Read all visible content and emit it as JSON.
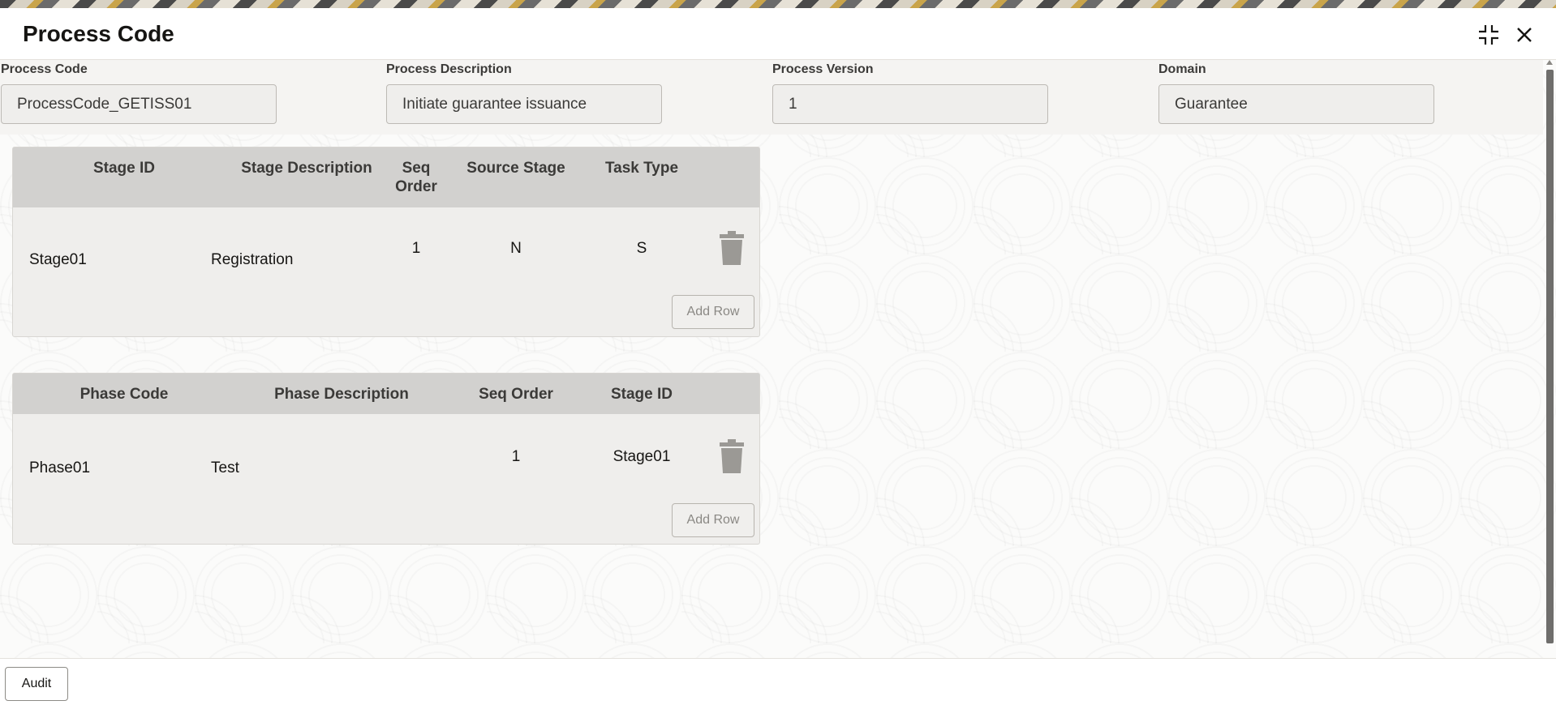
{
  "dialog": {
    "title": "Process Code"
  },
  "fields": {
    "process_code": {
      "label": "Process Code",
      "value": "ProcessCode_GETISS01"
    },
    "process_description": {
      "label": "Process Description",
      "value": "Initiate guarantee issuance"
    },
    "process_version": {
      "label": "Process Version",
      "value": "1"
    },
    "domain": {
      "label": "Domain",
      "value": "Guarantee"
    }
  },
  "stage_grid": {
    "headers": {
      "stage_id": "Stage ID",
      "stage_description": "Stage Description",
      "seq_order": "Seq Order",
      "source_stage": "Source Stage",
      "task_type": "Task Type"
    },
    "rows": [
      {
        "stage_id": "Stage01",
        "stage_description": "Registration",
        "seq_order": "1",
        "source_stage": "N",
        "task_type": "S"
      }
    ],
    "add_row_label": "Add Row"
  },
  "phase_grid": {
    "headers": {
      "phase_code": "Phase Code",
      "phase_description": "Phase Description",
      "seq_order": "Seq Order",
      "stage_id": "Stage ID"
    },
    "rows": [
      {
        "phase_code": "Phase01",
        "phase_description": "Test",
        "seq_order": "1",
        "stage_id": "Stage01"
      }
    ],
    "add_row_label": "Add Row"
  },
  "footer": {
    "audit_label": "Audit"
  },
  "icons": {
    "collapse": "collapse-icon",
    "close": "close-icon",
    "delete": "trash-icon"
  },
  "colors": {
    "header_row": "#d2d1cf",
    "grid_bg": "#efeeec",
    "trash": "#9b9995"
  }
}
